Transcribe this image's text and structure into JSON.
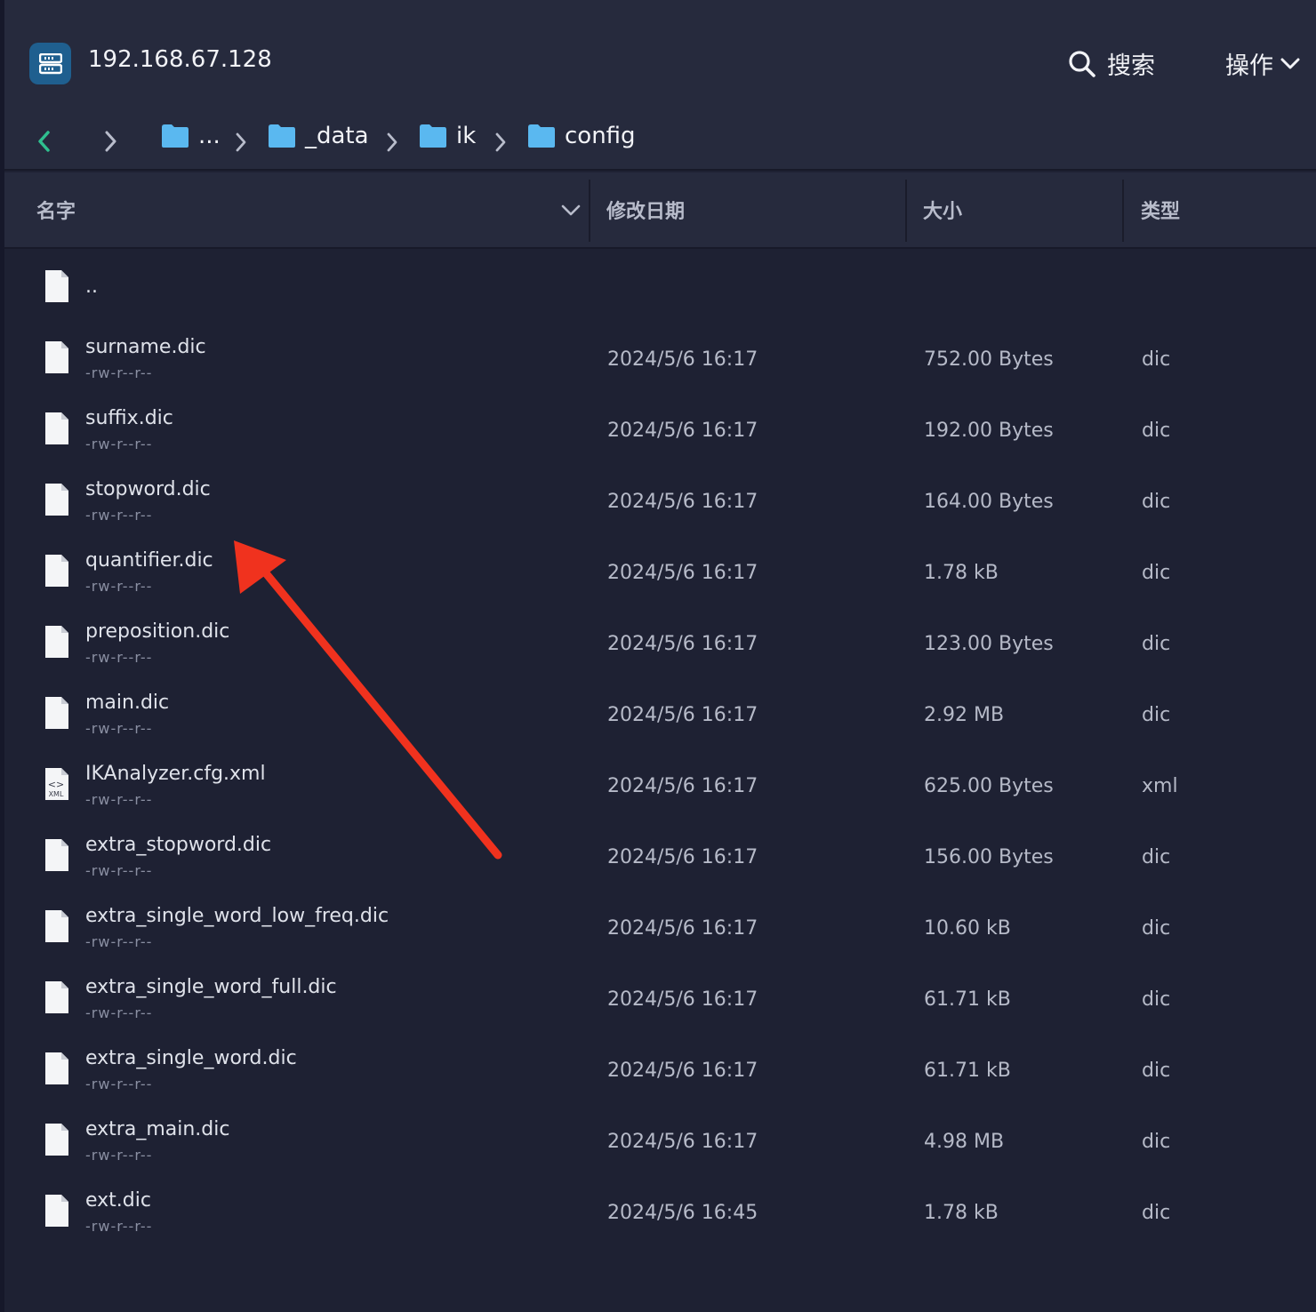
{
  "header": {
    "host": "192.168.67.128",
    "search_label": "搜索",
    "actions_label": "操作"
  },
  "breadcrumb": [
    {
      "label": "..."
    },
    {
      "label": "_data"
    },
    {
      "label": "ik"
    },
    {
      "label": "config"
    }
  ],
  "columns": {
    "name": "名字",
    "modified": "修改日期",
    "size": "大小",
    "type": "类型"
  },
  "files": [
    {
      "name": "..",
      "perm": "",
      "date": "",
      "size": "",
      "type": "",
      "icon": "file-icon"
    },
    {
      "name": "surname.dic",
      "perm": "-rw-r--r--",
      "date": "2024/5/6 16:17",
      "size": "752.00 Bytes",
      "type": "dic",
      "icon": "file-icon"
    },
    {
      "name": "suffix.dic",
      "perm": "-rw-r--r--",
      "date": "2024/5/6 16:17",
      "size": "192.00 Bytes",
      "type": "dic",
      "icon": "file-icon"
    },
    {
      "name": "stopword.dic",
      "perm": "-rw-r--r--",
      "date": "2024/5/6 16:17",
      "size": "164.00 Bytes",
      "type": "dic",
      "icon": "file-icon"
    },
    {
      "name": "quantifier.dic",
      "perm": "-rw-r--r--",
      "date": "2024/5/6 16:17",
      "size": "1.78 kB",
      "type": "dic",
      "icon": "file-icon"
    },
    {
      "name": "preposition.dic",
      "perm": "-rw-r--r--",
      "date": "2024/5/6 16:17",
      "size": "123.00 Bytes",
      "type": "dic",
      "icon": "file-icon"
    },
    {
      "name": "main.dic",
      "perm": "-rw-r--r--",
      "date": "2024/5/6 16:17",
      "size": "2.92 MB",
      "type": "dic",
      "icon": "file-icon"
    },
    {
      "name": "IKAnalyzer.cfg.xml",
      "perm": "-rw-r--r--",
      "date": "2024/5/6 16:17",
      "size": "625.00 Bytes",
      "type": "xml",
      "icon": "xml-file-icon",
      "icon_text": "XML"
    },
    {
      "name": "extra_stopword.dic",
      "perm": "-rw-r--r--",
      "date": "2024/5/6 16:17",
      "size": "156.00 Bytes",
      "type": "dic",
      "icon": "file-icon"
    },
    {
      "name": "extra_single_word_low_freq.dic",
      "perm": "-rw-r--r--",
      "date": "2024/5/6 16:17",
      "size": "10.60 kB",
      "type": "dic",
      "icon": "file-icon"
    },
    {
      "name": "extra_single_word_full.dic",
      "perm": "-rw-r--r--",
      "date": "2024/5/6 16:17",
      "size": "61.71 kB",
      "type": "dic",
      "icon": "file-icon"
    },
    {
      "name": "extra_single_word.dic",
      "perm": "-rw-r--r--",
      "date": "2024/5/6 16:17",
      "size": "61.71 kB",
      "type": "dic",
      "icon": "file-icon"
    },
    {
      "name": "extra_main.dic",
      "perm": "-rw-r--r--",
      "date": "2024/5/6 16:17",
      "size": "4.98 MB",
      "type": "dic",
      "icon": "file-icon"
    },
    {
      "name": "ext.dic",
      "perm": "-rw-r--r--",
      "date": "2024/5/6 16:45",
      "size": "1.78 kB",
      "type": "dic",
      "icon": "file-icon"
    }
  ],
  "colors": {
    "background": "#1e2133",
    "header": "#262a3d",
    "folder": "#5ab8f0",
    "back_arrow": "#2fbf8f",
    "annotation_arrow": "#f0321e"
  }
}
